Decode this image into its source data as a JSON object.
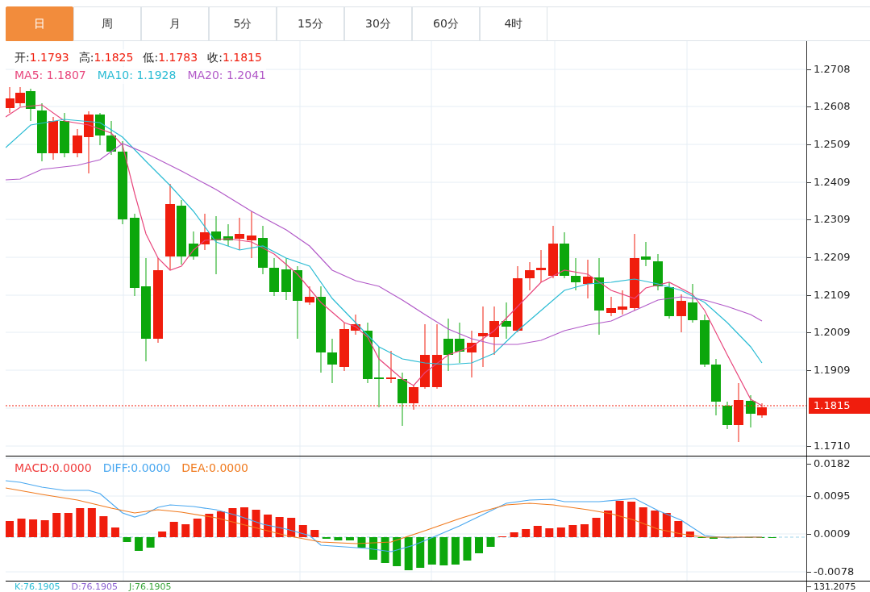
{
  "tabs": [
    {
      "label": "日",
      "selected": true
    },
    {
      "label": "周",
      "selected": false
    },
    {
      "label": "月",
      "selected": false
    },
    {
      "label": "5分",
      "selected": false
    },
    {
      "label": "15分",
      "selected": false
    },
    {
      "label": "30分",
      "selected": false
    },
    {
      "label": "60分",
      "selected": false
    },
    {
      "label": "4时",
      "selected": false
    }
  ],
  "quote": [
    {
      "label": "开:",
      "value": "1.1793"
    },
    {
      "label": "高:",
      "value": "1.1825"
    },
    {
      "label": "低:",
      "value": "1.1783"
    },
    {
      "label": "收:",
      "value": "1.1815"
    }
  ],
  "moving_averages": [
    {
      "label": "MA5:",
      "value": "1.1807",
      "color": "#e8467c"
    },
    {
      "label": "MA10:",
      "value": "1.1928",
      "color": "#2bbcd4"
    },
    {
      "label": "MA20:",
      "value": "1.2041",
      "color": "#b25ac8"
    }
  ],
  "price_axis": [
    "1.2708",
    "1.2608",
    "1.2509",
    "1.2409",
    "1.2309",
    "1.2209",
    "1.2109",
    "1.2009",
    "1.1909",
    "1.1710"
  ],
  "current_price": "1.1815",
  "macd_legend": [
    {
      "label": "MACD:",
      "value": "0.0000",
      "color": "#f03b3b"
    },
    {
      "label": "DIFF:",
      "value": "0.0000",
      "color": "#4aa8f0"
    },
    {
      "label": "DEA:",
      "value": "0.0000",
      "color": "#f07a1e"
    }
  ],
  "macd_axis": [
    "0.0182",
    "0.0095",
    "0.0009",
    "-0.0078"
  ],
  "kdj_legend": [
    {
      "label": "K:",
      "value": "76.1905",
      "color": "#2bbcd4"
    },
    {
      "label": "D:",
      "value": "76.1905",
      "color": "#8a5fd0"
    },
    {
      "label": "J:",
      "value": "76.1905",
      "color": "#3aa53a"
    }
  ],
  "kdj_axis": [
    "131.2075"
  ]
}
